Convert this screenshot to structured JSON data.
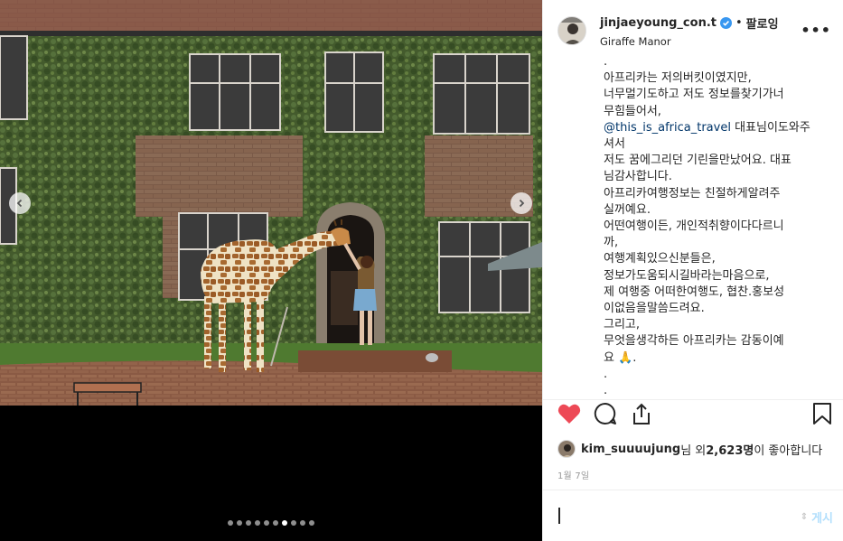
{
  "post": {
    "username": "jinjaeyoung_con.t",
    "separator": "•",
    "follow_label": "팔로잉",
    "location": "Giraffe Manor",
    "more_label": "•••"
  },
  "caption_lines": [
    ".",
    "아프리카는 저의버킷이였지만,",
    "너무멀기도하고 저도 정보를찾기가너",
    "무힘들어서,",
    "@this_is_africa_travel 대표님이도와주",
    "셔서",
    "저도 꿈에그리던 기린을만났어요. 대표",
    "님감사합니다.",
    "아프리카여행정보는 친절하게알려주",
    "실꺼예요.",
    "어떤여행이든, 개인적취향이다다르니",
    "까,",
    "여행계획있으신분들은,",
    "정보가도움되시길바라는마음으로,",
    "제 여행중 어떠한여행도, 협찬.홍보성",
    "이없음을말씀드려요.",
    "그리고,",
    "무엇을생각하든 아프리카는 감동이예",
    "요 🙏.",
    ".",
    "."
  ],
  "mention": "@this_is_africa_travel",
  "mention_rest": " 대표님이도와주",
  "likes": {
    "user": "kim_suuuujung",
    "suffix": "님 외 ",
    "count": "2,623명",
    "tail": "이 좋아합니다"
  },
  "date": "1월 7일",
  "compose": {
    "placeholder": "",
    "post_label": "게시"
  },
  "carousel": {
    "total": 10,
    "active_index": 6
  },
  "icons": {
    "like": "heart-filled-icon",
    "comment": "comment-icon",
    "share": "share-icon",
    "save": "bookmark-icon",
    "verified": "verified-badge-icon",
    "prev": "chevron-left-icon",
    "next": "chevron-right-icon"
  },
  "colors": {
    "like": "#ed4956",
    "verified": "#3897f0",
    "mention": "#003569",
    "post_button": "#b2dffc"
  }
}
